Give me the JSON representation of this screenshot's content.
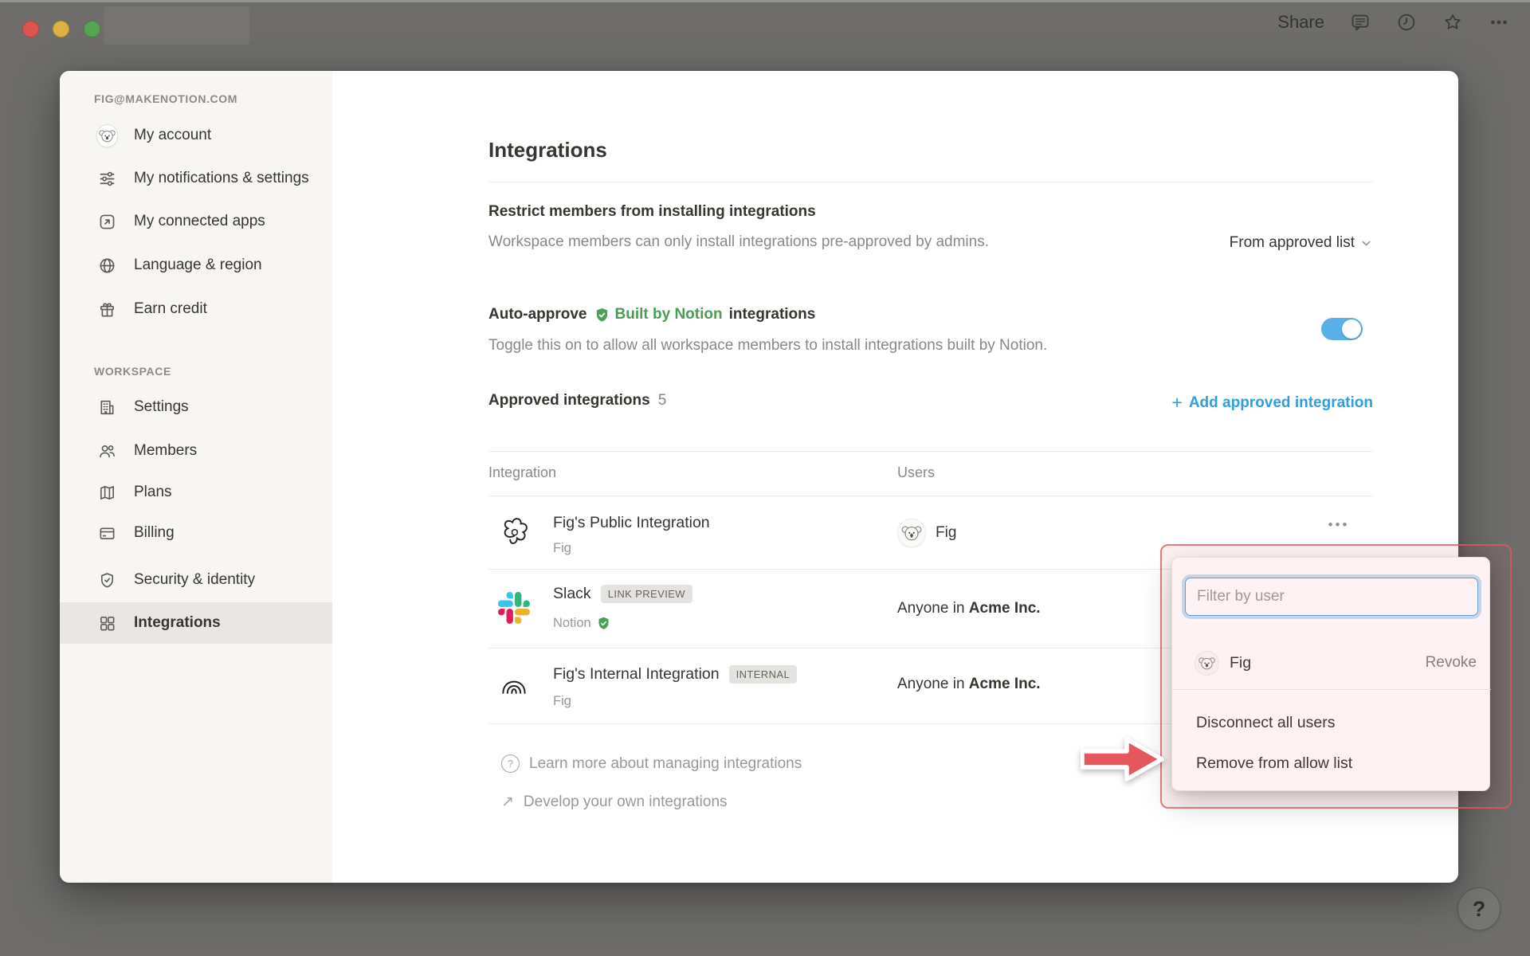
{
  "colors": {
    "overlay_background": "#6e6d6b",
    "sidebar_background": "#f7f6f3",
    "selected_item_background": "#e9e7e3",
    "text_primary": "#37352f",
    "text_secondary": "#8b8883",
    "accent_blue": "#2d9fe1",
    "toggle_blue": "#57b0e6",
    "notion_green": "#4a9e52",
    "annotation_red": "#e0595e"
  },
  "topbar": {
    "share_label": "Share"
  },
  "icons": {
    "ellipsis": "•••",
    "question_mark": "?",
    "arrow_up_right": "↗",
    "plus": "+"
  },
  "sidebar": {
    "account_label": "FIG@MAKENOTION.COM",
    "account_items": [
      {
        "label": "My account"
      },
      {
        "label": "My notifications & settings"
      },
      {
        "label": "My connected apps"
      },
      {
        "label": "Language & region"
      },
      {
        "label": "Earn credit"
      }
    ],
    "workspace_label": "WORKSPACE",
    "workspace_items": [
      {
        "label": "Settings"
      },
      {
        "label": "Members"
      },
      {
        "label": "Plans"
      },
      {
        "label": "Billing"
      },
      {
        "label": "Security & identity"
      },
      {
        "label": "Integrations",
        "selected": true
      }
    ]
  },
  "main": {
    "title": "Integrations",
    "restrict": {
      "title": "Restrict members from installing integrations",
      "desc": "Workspace members can only install integrations pre-approved by admins.",
      "value": "From approved list"
    },
    "auto_approve": {
      "prefix": "Auto-approve",
      "badge": "Built by Notion",
      "suffix": "integrations",
      "desc": "Toggle this on to allow all workspace members to install integrations built by Notion.",
      "toggle_state": "on"
    },
    "approved": {
      "title": "Approved integrations",
      "count": "5",
      "add_label": "Add approved integration"
    },
    "table": {
      "col_integration": "Integration",
      "col_users": "Users",
      "rows": [
        {
          "name": "Fig's Public Integration",
          "sub": "Fig",
          "user": "Fig"
        },
        {
          "name": "Slack",
          "badge": "LINK PREVIEW",
          "sub": "Notion",
          "users_prefix": "Anyone in",
          "users_bold": "Acme Inc."
        },
        {
          "name": "Fig's Internal Integration",
          "badge": "INTERNAL",
          "sub": "Fig",
          "users_prefix": "Anyone in",
          "users_bold": "Acme Inc."
        }
      ]
    },
    "links": [
      {
        "label": "Learn more about managing integrations"
      },
      {
        "label": "Develop your own integrations"
      }
    ]
  },
  "popup": {
    "filter_placeholder": "Filter by user",
    "user_name": "Fig",
    "revoke_label": "Revoke",
    "items": [
      {
        "label": "Disconnect all users"
      },
      {
        "label": "Remove from allow list"
      }
    ]
  },
  "help_label": "?"
}
